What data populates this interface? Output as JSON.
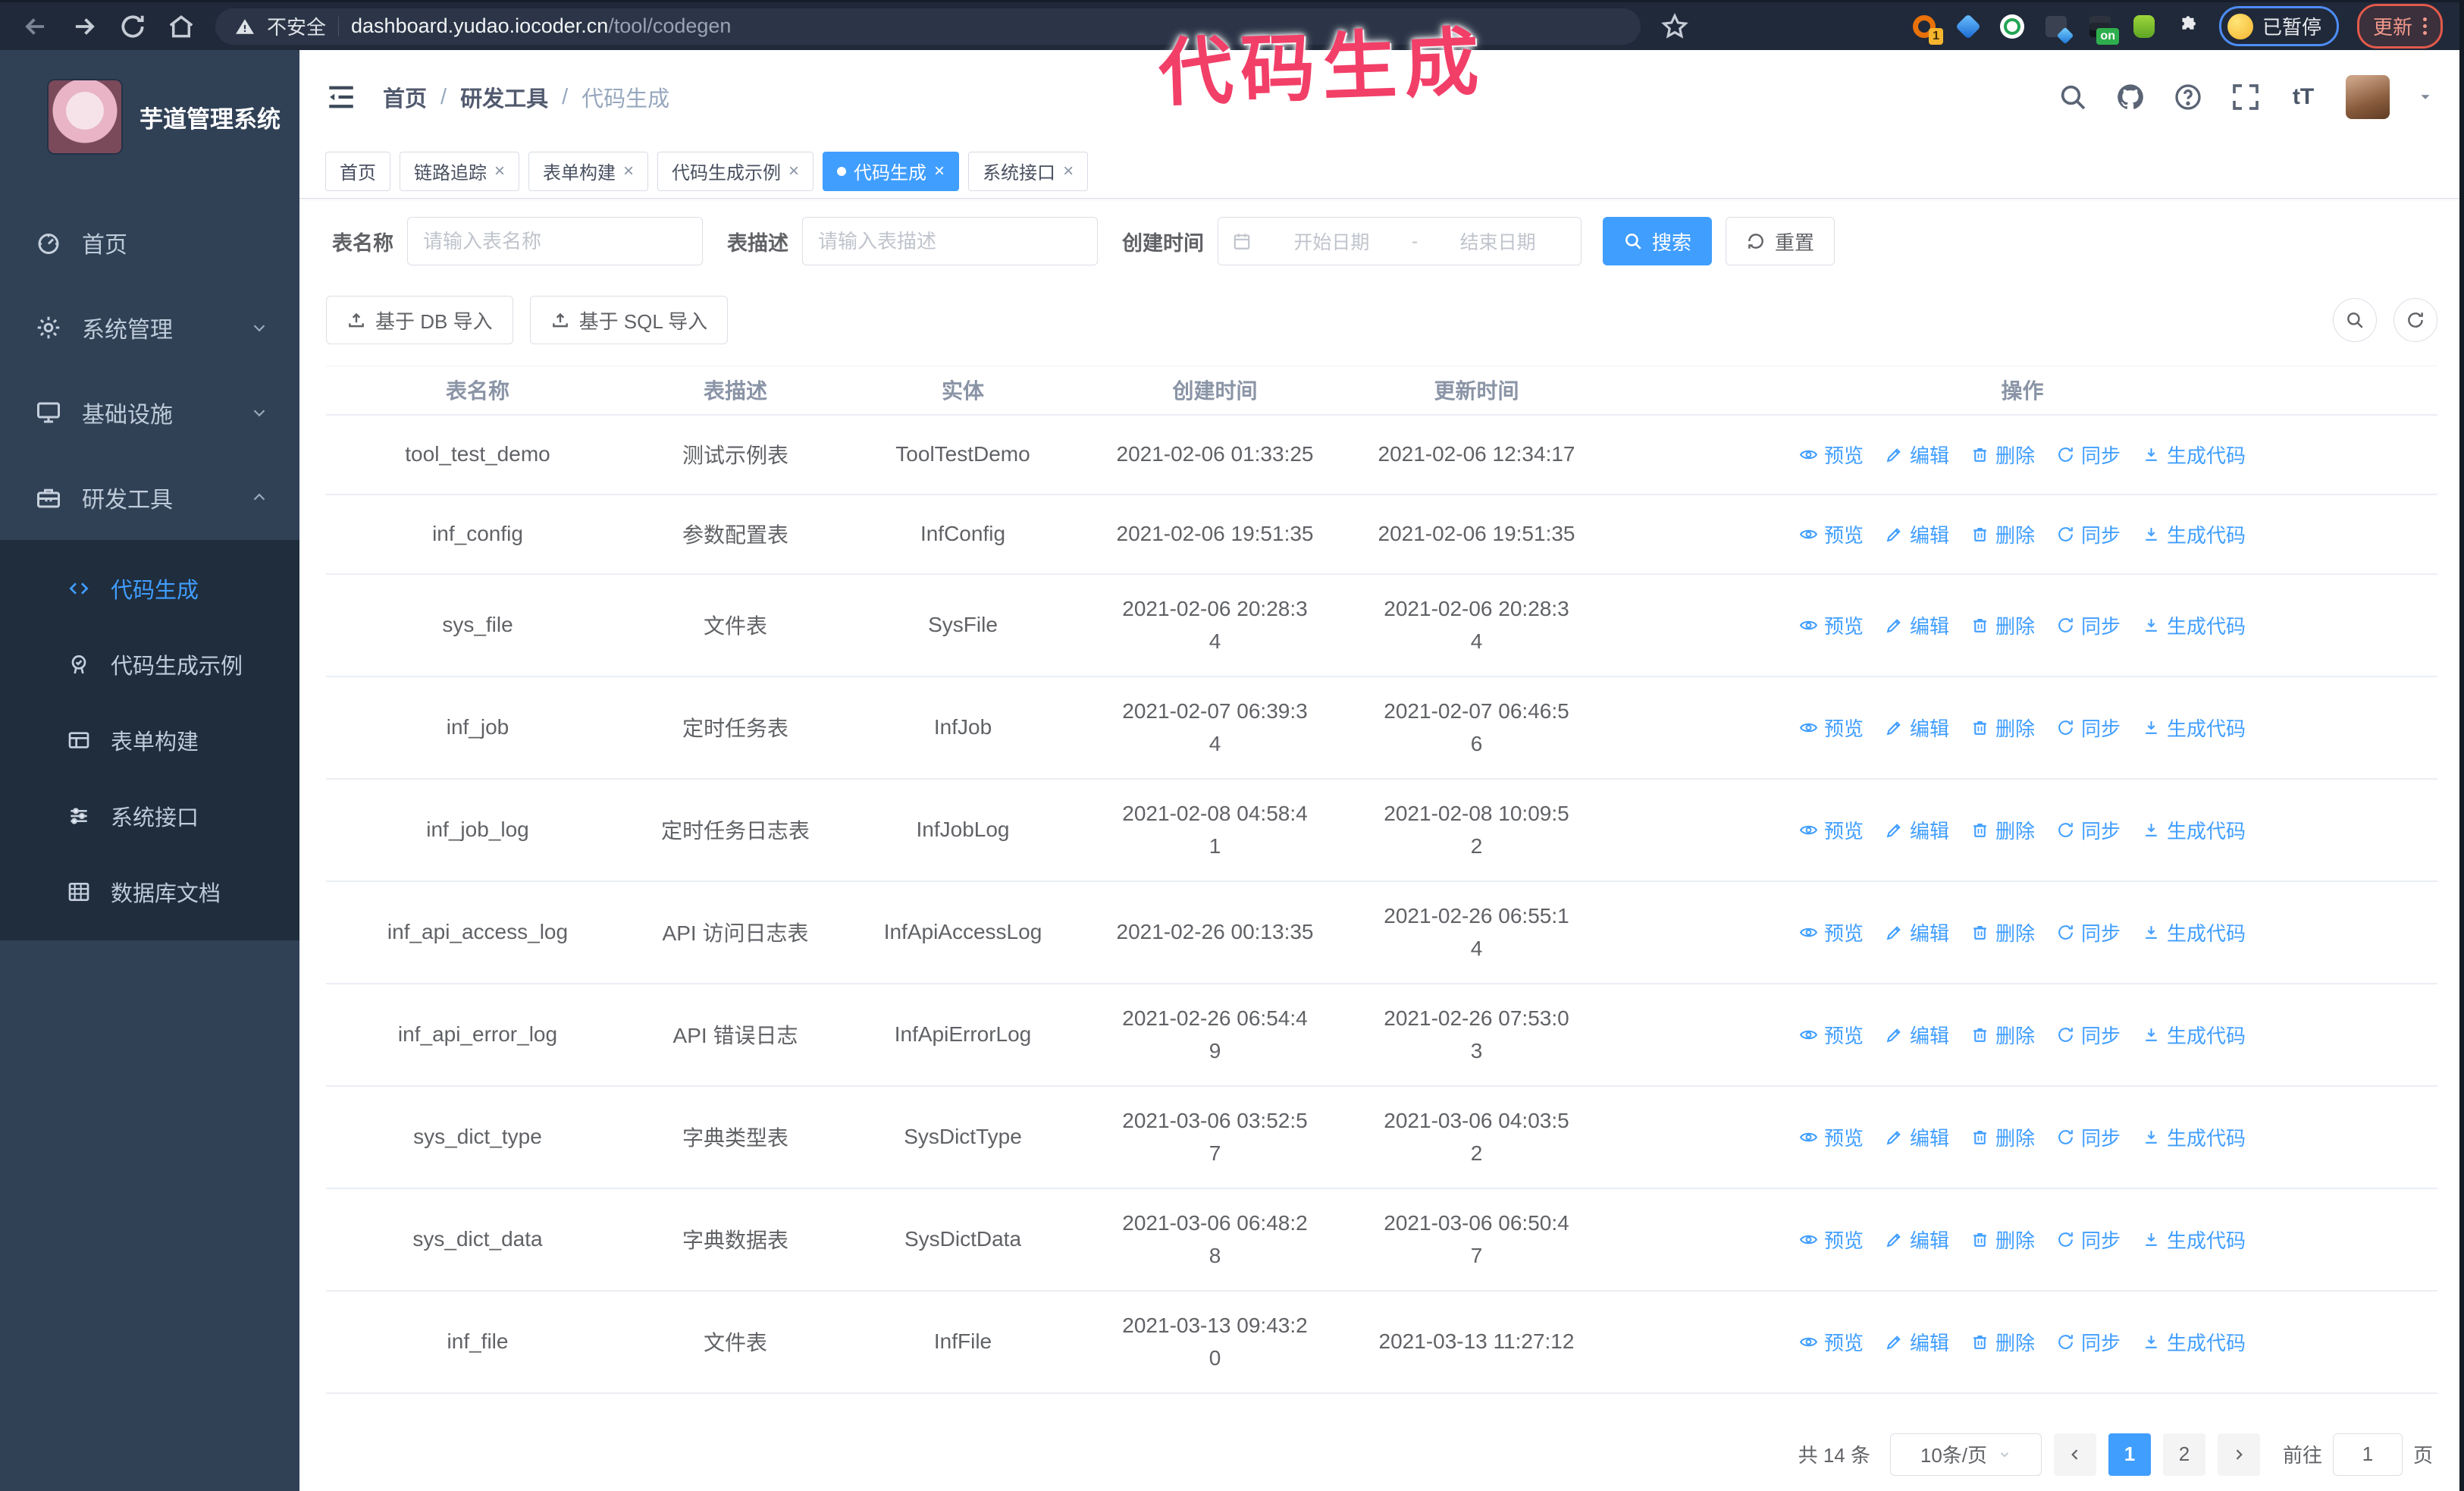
{
  "browser": {
    "security_warning": "不安全",
    "url_host": "dashboard.yudao.iocoder.cn",
    "url_path": "/tool/codegen",
    "extension_badge": "1",
    "on_badge": "on",
    "paused_badge": "已暂停",
    "update_button": "更新"
  },
  "annotation": {
    "text": "代码生成",
    "color": "#f23f68"
  },
  "sidebar": {
    "logo_title": "芋道管理系统",
    "menu": [
      {
        "label": "首页",
        "icon": "dashboard-icon",
        "chevron": "none"
      },
      {
        "label": "系统管理",
        "icon": "gear-icon",
        "chevron": "down"
      },
      {
        "label": "基础设施",
        "icon": "monitor-icon",
        "chevron": "down"
      },
      {
        "label": "研发工具",
        "icon": "toolbox-icon",
        "chevron": "up"
      }
    ],
    "submenu": [
      {
        "label": "代码生成",
        "icon": "code-icon",
        "active": true
      },
      {
        "label": "代码生成示例",
        "icon": "example-icon",
        "active": false
      },
      {
        "label": "表单构建",
        "icon": "form-icon",
        "active": false
      },
      {
        "label": "系统接口",
        "icon": "sliders-icon",
        "active": false
      },
      {
        "label": "数据库文档",
        "icon": "database-icon",
        "active": false
      }
    ]
  },
  "header": {
    "breadcrumb": [
      "首页",
      "研发工具",
      "代码生成"
    ],
    "breadcrumb_separator": "/"
  },
  "tabs": [
    {
      "label": "首页",
      "closable": false,
      "active": false
    },
    {
      "label": "链路追踪",
      "closable": true,
      "active": false
    },
    {
      "label": "表单构建",
      "closable": true,
      "active": false
    },
    {
      "label": "代码生成示例",
      "closable": true,
      "active": false
    },
    {
      "label": "代码生成",
      "closable": true,
      "active": true
    },
    {
      "label": "系统接口",
      "closable": true,
      "active": false
    }
  ],
  "filters": {
    "table_name_label": "表名称",
    "table_name_placeholder": "请输入表名称",
    "table_desc_label": "表描述",
    "table_desc_placeholder": "请输入表描述",
    "create_time_label": "创建时间",
    "start_date_placeholder": "开始日期",
    "range_separator": "-",
    "end_date_placeholder": "结束日期",
    "search_button": "搜索",
    "reset_button": "重置"
  },
  "toolbar": {
    "import_db_button": "基于 DB 导入",
    "import_sql_button": "基于 SQL 导入"
  },
  "table": {
    "columns": [
      "表名称",
      "表描述",
      "实体",
      "创建时间",
      "更新时间",
      "操作"
    ],
    "actions": [
      {
        "label": "预览",
        "icon": "eye-icon"
      },
      {
        "label": "编辑",
        "icon": "edit-icon"
      },
      {
        "label": "删除",
        "icon": "trash-icon"
      },
      {
        "label": "同步",
        "icon": "sync-icon"
      },
      {
        "label": "生成代码",
        "icon": "download-icon"
      }
    ],
    "rows": [
      {
        "name": "tool_test_demo",
        "desc": "测试示例表",
        "entity": "ToolTestDemo",
        "created": "2021-02-06 01:33:25",
        "updated": "2021-02-06 12:34:17",
        "tall": false
      },
      {
        "name": "inf_config",
        "desc": "参数配置表",
        "entity": "InfConfig",
        "created": "2021-02-06 19:51:35",
        "updated": "2021-02-06 19:51:35",
        "tall": false
      },
      {
        "name": "sys_file",
        "desc": "文件表",
        "entity": "SysFile",
        "created": "2021-02-06 20:28:3\n4",
        "updated": "2021-02-06 20:28:3\n4",
        "tall": true
      },
      {
        "name": "inf_job",
        "desc": "定时任务表",
        "entity": "InfJob",
        "created": "2021-02-07 06:39:3\n4",
        "updated": "2021-02-07 06:46:5\n6",
        "tall": true
      },
      {
        "name": "inf_job_log",
        "desc": "定时任务日志表",
        "entity": "InfJobLog",
        "created": "2021-02-08 04:58:4\n1",
        "updated": "2021-02-08 10:09:5\n2",
        "tall": true
      },
      {
        "name": "inf_api_access_log",
        "desc": "API 访问日志表",
        "entity": "InfApiAccessLog",
        "created": "2021-02-26 00:13:35",
        "updated": "2021-02-26 06:55:1\n4",
        "tall": true
      },
      {
        "name": "inf_api_error_log",
        "desc": "API 错误日志",
        "entity": "InfApiErrorLog",
        "created": "2021-02-26 06:54:4\n9",
        "updated": "2021-02-26 07:53:0\n3",
        "tall": true
      },
      {
        "name": "sys_dict_type",
        "desc": "字典类型表",
        "entity": "SysDictType",
        "created": "2021-03-06 03:52:5\n7",
        "updated": "2021-03-06 04:03:5\n2",
        "tall": true
      },
      {
        "name": "sys_dict_data",
        "desc": "字典数据表",
        "entity": "SysDictData",
        "created": "2021-03-06 06:48:2\n8",
        "updated": "2021-03-06 06:50:4\n7",
        "tall": true
      },
      {
        "name": "inf_file",
        "desc": "文件表",
        "entity": "InfFile",
        "created": "2021-03-13 09:43:2\n0",
        "updated": "2021-03-13 11:27:12",
        "tall": true
      }
    ]
  },
  "pagination": {
    "total_text": "共 14 条",
    "page_size": "10条/页",
    "pages": [
      "1",
      "2"
    ],
    "active_page": "1",
    "goto_label": "前往",
    "goto_value": "1",
    "page_label": "页"
  }
}
